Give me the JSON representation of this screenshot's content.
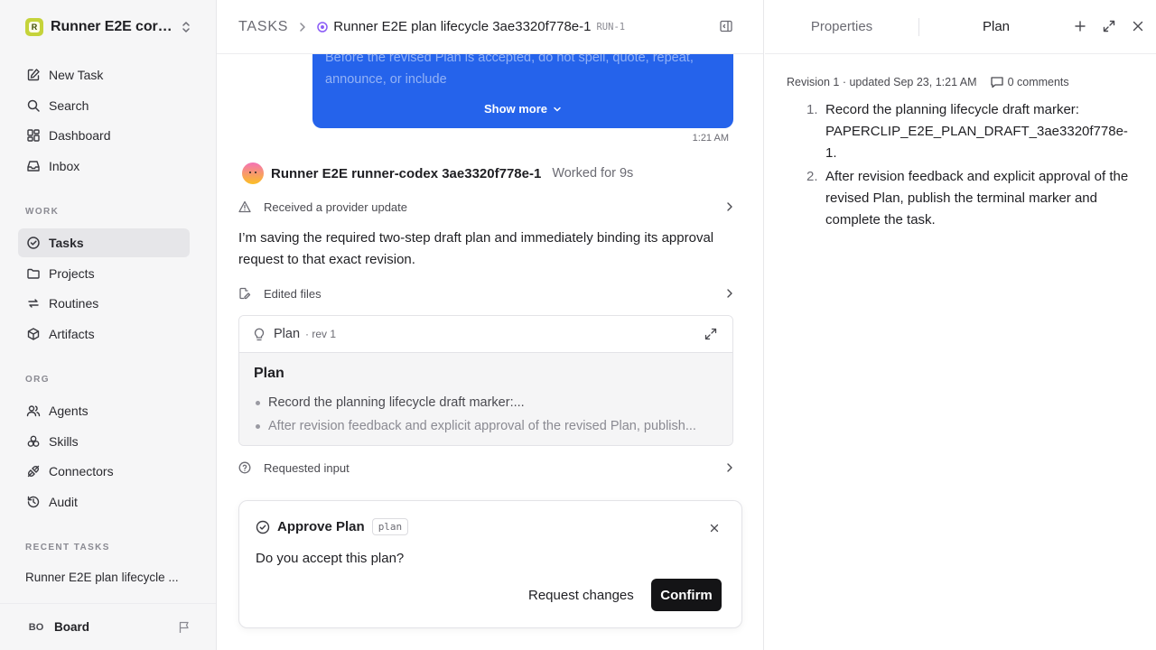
{
  "sidebar": {
    "workspace": {
      "name": "Runner E2E core-...",
      "logo_letter": "R"
    },
    "nav": [
      {
        "label": "New Task",
        "icon": "new-task-icon"
      },
      {
        "label": "Search",
        "icon": "search-icon"
      },
      {
        "label": "Dashboard",
        "icon": "dashboard-icon"
      },
      {
        "label": "Inbox",
        "icon": "inbox-icon"
      }
    ],
    "work_label": "WORK",
    "work": [
      {
        "label": "Tasks",
        "icon": "tasks-icon",
        "active": true
      },
      {
        "label": "Projects",
        "icon": "projects-icon"
      },
      {
        "label": "Routines",
        "icon": "routines-icon"
      },
      {
        "label": "Artifacts",
        "icon": "artifacts-icon"
      }
    ],
    "org_label": "ORG",
    "org": [
      {
        "label": "Agents",
        "icon": "agents-icon"
      },
      {
        "label": "Skills",
        "icon": "skills-icon"
      },
      {
        "label": "Connectors",
        "icon": "connectors-icon"
      },
      {
        "label": "Audit",
        "icon": "audit-icon"
      }
    ],
    "recent_label": "RECENT TASKS",
    "recent": [
      {
        "label": "Runner E2E plan lifecycle ..."
      }
    ],
    "footer": {
      "initials": "BO",
      "label": "Board"
    }
  },
  "header": {
    "root": "TASKS",
    "title": "Runner E2E plan lifecycle 3ae3320f778e-1",
    "run_id": "RUN-1"
  },
  "thread": {
    "user_message_excerpt": "Before the revised Plan is accepted, do not spell, quote, repeat, announce, or include",
    "show_more": "Show more",
    "time": "1:21 AM",
    "agent_name": "Runner E2E runner-codex 3ae3320f778e-1",
    "worked_for": "Worked for 9s",
    "event_provider": "Received a provider update",
    "message": "I’m saving the required two-step draft plan and immediately binding its approval request to that exact revision.",
    "event_files": "Edited files",
    "plan_card": {
      "label": "Plan",
      "rev": "· rev 1",
      "heading": "Plan",
      "items": [
        "Record the planning lifecycle draft marker:...",
        "After revision feedback and explicit approval of the revised Plan, publish..."
      ]
    },
    "event_input": "Requested input"
  },
  "approval": {
    "title": "Approve Plan",
    "tag": "plan",
    "question": "Do you accept this plan?",
    "secondary": "Request changes",
    "primary": "Confirm"
  },
  "right_panel": {
    "tabs": [
      "Properties",
      "Plan"
    ],
    "active_tab": "Plan",
    "revision_meta": "Revision 1 · updated Sep 23, 1:21 AM",
    "comments": "0 comments",
    "items": [
      {
        "num": "1.",
        "text": "Record the planning lifecycle draft marker: PAPERCLIP_E2E_PLAN_DRAFT_3ae3320f778e-1."
      },
      {
        "num": "2.",
        "text": "After revision feedback and explicit approval of the revised Plan, publish the terminal marker and complete the task."
      }
    ]
  },
  "colors": {
    "accent_blue": "#2563eb",
    "primary_button": "#141416",
    "workspace_logo": "#c5d33a"
  }
}
